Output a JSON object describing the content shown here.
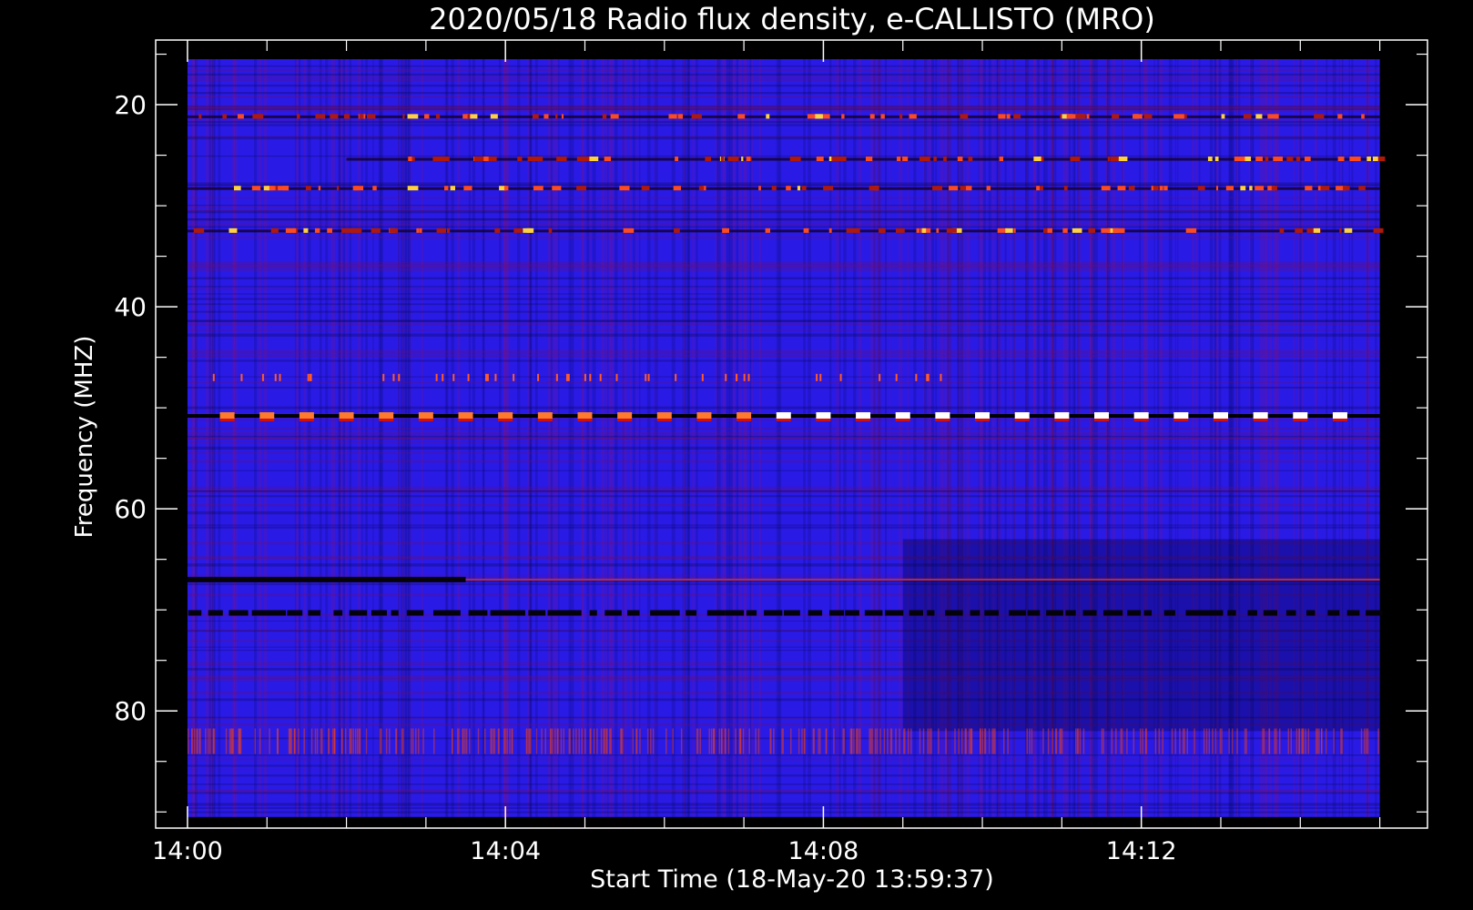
{
  "chart_data": {
    "type": "heatmap",
    "title": "2020/05/18  Radio flux density, e-CALLISTO (MRO)",
    "xlabel": "Start Time (18-May-20 13:59:37)",
    "ylabel": "Frequency (MHZ)",
    "x_start": "14:00",
    "x_end": "14:15",
    "xlim_minutes": [
      -0.4,
      15.6
    ],
    "ylim": [
      91.6,
      13.6
    ],
    "data_range_minutes": [
      0,
      15
    ],
    "data_range_frequency": [
      15.5,
      90.5
    ],
    "x_ticks": [
      {
        "label": "14:00",
        "minute": 0
      },
      {
        "label": "14:04",
        "minute": 4
      },
      {
        "label": "14:08",
        "minute": 8
      },
      {
        "label": "14:12",
        "minute": 12
      }
    ],
    "y_ticks": [
      {
        "label": "20",
        "value": 20
      },
      {
        "label": "40",
        "value": 40
      },
      {
        "label": "60",
        "value": 60
      },
      {
        "label": "80",
        "value": 80
      }
    ],
    "background_color": "#2a1ae6",
    "colors": {
      "low": "#000010",
      "mid": "#1a1aff",
      "high": "#c01a0a",
      "peak": "#ffffff"
    },
    "bands": [
      {
        "frequency": 21.2,
        "kind": "hot-dashes",
        "start": 0.0,
        "end": 15.0
      },
      {
        "frequency": 25.4,
        "kind": "hot-dashes",
        "start": 2.0,
        "end": 15.0
      },
      {
        "frequency": 28.3,
        "kind": "hot-dashes",
        "start": 0.0,
        "end": 15.0
      },
      {
        "frequency": 32.5,
        "kind": "hot-dashes",
        "start": 0.0,
        "end": 15.0
      },
      {
        "frequency": 47.0,
        "kind": "warm-ticks",
        "start": 0.2,
        "end": 9.5
      },
      {
        "frequency": 50.8,
        "kind": "bright-dashes",
        "start": 0.0,
        "end": 15.0
      },
      {
        "frequency": 67.0,
        "kind": "dark-line",
        "start": 0.0,
        "end": 3.5
      },
      {
        "frequency": 70.3,
        "kind": "dark-dashes",
        "start": 0.0,
        "end": 15.0
      },
      {
        "frequency": 83.0,
        "kind": "fine-stripes",
        "start": 0.0,
        "end": 15.0
      }
    ]
  }
}
